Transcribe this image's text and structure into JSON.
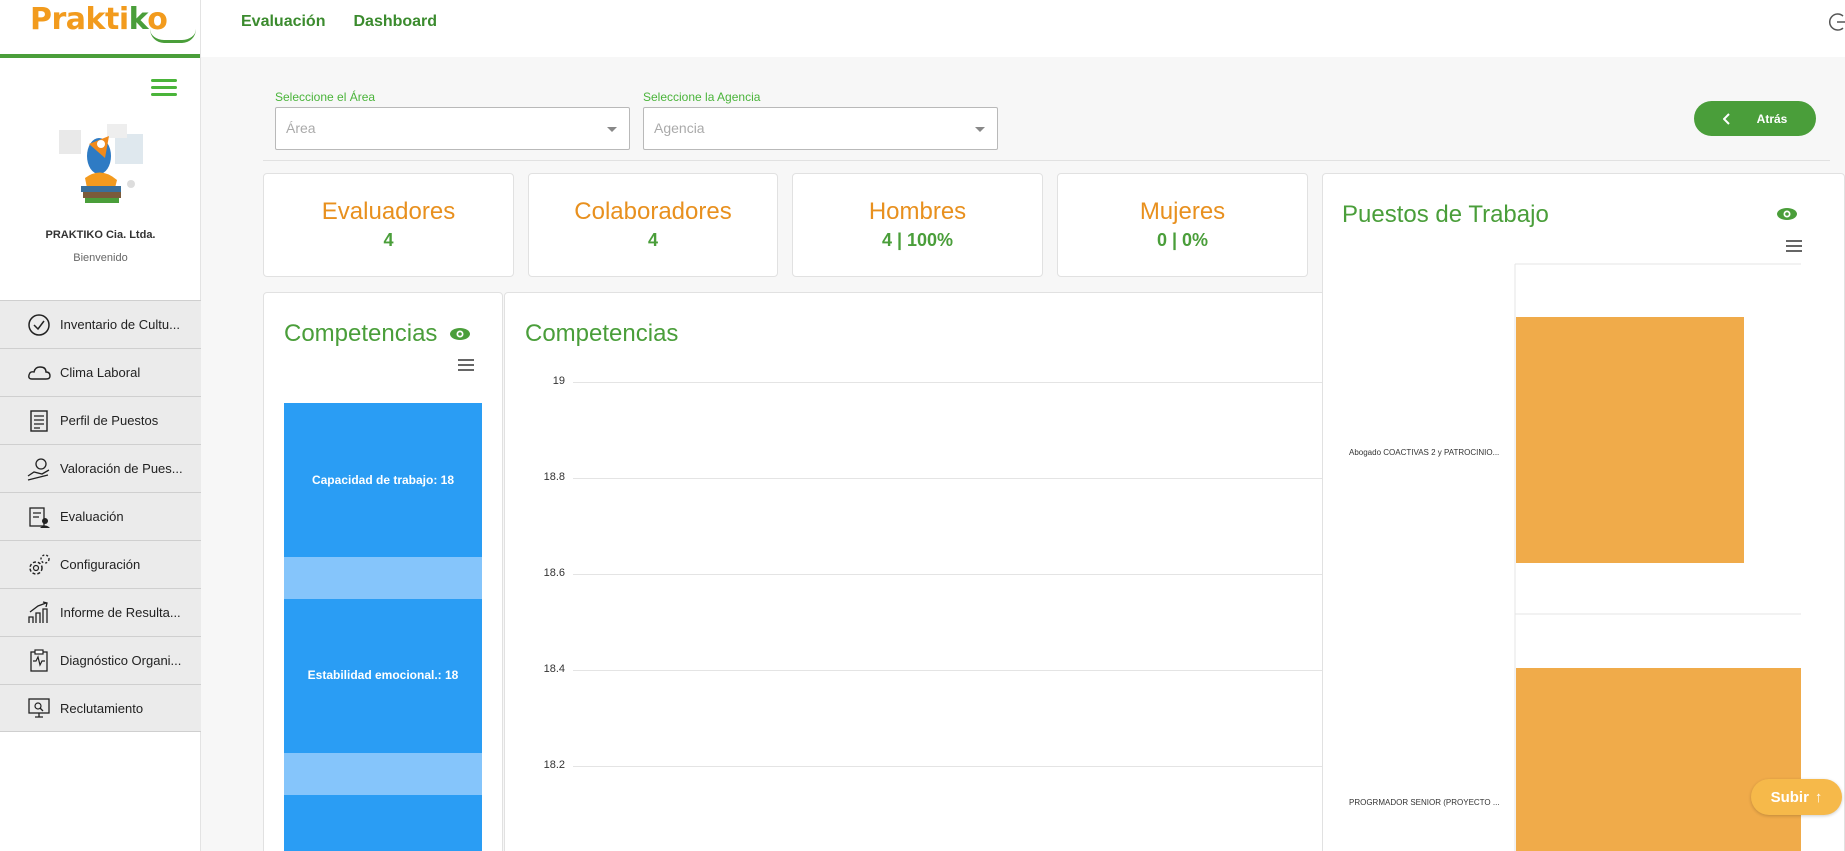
{
  "brand": {
    "logo_main": "Prakti",
    "logo_accent": "k",
    "logo_end": "o"
  },
  "sidebar": {
    "company": "PRAKTIKO Cia. Ltda.",
    "welcome": "Bienvenido",
    "items": [
      {
        "label": "Inventario de Cultu...",
        "icon": "check-circle-icon"
      },
      {
        "label": "Clima Laboral",
        "icon": "cloud-icon"
      },
      {
        "label": "Perfil de Puestos",
        "icon": "document-list-icon"
      },
      {
        "label": "Valoración de Pues...",
        "icon": "hand-money-icon"
      },
      {
        "label": "Evaluación",
        "icon": "clipboard-user-icon"
      },
      {
        "label": "Configuración",
        "icon": "gears-icon"
      },
      {
        "label": "Informe de Resulta...",
        "icon": "chart-growth-icon"
      },
      {
        "label": "Diagnóstico Organi...",
        "icon": "clipboard-pulse-icon"
      },
      {
        "label": "Reclutamiento",
        "icon": "monitor-search-icon"
      }
    ]
  },
  "topnav": {
    "items": [
      "Evaluación",
      "Dashboard"
    ]
  },
  "filters": {
    "area_label": "Seleccione el Área",
    "area_placeholder": "Área",
    "agency_label": "Seleccione la Agencia",
    "agency_placeholder": "Agencia"
  },
  "back_button": "Atrás",
  "stats": [
    {
      "title": "Evaluadores",
      "value": "4"
    },
    {
      "title": "Colaboradores",
      "value": "4"
    },
    {
      "title": "Hombres",
      "value": "4 | 100%"
    },
    {
      "title": "Mujeres",
      "value": "0 | 0%"
    }
  ],
  "competencias_panel": {
    "title": "Competencias",
    "bars": [
      {
        "label": "Capacidad de trabajo: 18"
      },
      {
        "label": "Estabilidad emocional.: 18"
      }
    ]
  },
  "competencias_chart": {
    "title": "Competencias",
    "yticks": [
      "19",
      "18.8",
      "18.6",
      "18.4",
      "18.2"
    ]
  },
  "puestos_panel": {
    "title": "Puestos de Trabajo",
    "categories": [
      "Abogado COACTIVAS 2 y PATROCINIO...",
      "PROGRMADOR SENIOR (PROYECTO ..."
    ]
  },
  "subir_button": "Subir",
  "colors": {
    "green": "#4a9e3a",
    "orange": "#e8901e",
    "blue": "#2a9df4",
    "bar_orange": "#f0ab4a"
  },
  "chart_data": [
    {
      "type": "bar",
      "title": "Competencias",
      "categories": [
        "Capacidad de trabajo",
        "Estabilidad emocional."
      ],
      "values": [
        18,
        18
      ],
      "orientation": "horizontal"
    },
    {
      "type": "bar",
      "title": "Puestos de Trabajo",
      "categories": [
        "Abogado COACTIVAS 2 y PATROCINIO...",
        "PROGRMADOR SENIOR (PROYECTO ..."
      ],
      "orientation": "horizontal"
    }
  ]
}
